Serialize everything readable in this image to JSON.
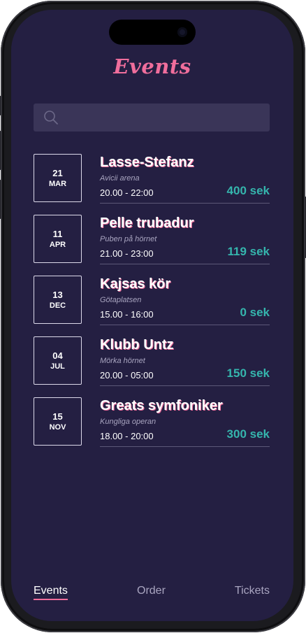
{
  "header": {
    "title": "Events"
  },
  "search": {
    "placeholder": "",
    "value": ""
  },
  "events": [
    {
      "day": "21",
      "month": "MAR",
      "name": "Lasse-Stefanz",
      "venue": "Avicii arena",
      "time": "20.00 - 22:00",
      "price": "400 sek"
    },
    {
      "day": "11",
      "month": "APR",
      "name": "Pelle trubadur",
      "venue": "Puben på hörnet",
      "time": "21.00 - 23:00",
      "price": "119 sek"
    },
    {
      "day": "13",
      "month": "DEC",
      "name": "Kajsas kör",
      "venue": "Götaplatsen",
      "time": "15.00 - 16:00",
      "price": "0 sek"
    },
    {
      "day": "04",
      "month": "JUL",
      "name": "Klubb Untz",
      "venue": "Mörka hörnet",
      "time": "20.00 - 05:00",
      "price": "150 sek"
    },
    {
      "day": "15",
      "month": "NOV",
      "name": "Greats symfoniker",
      "venue": "Kungliga operan",
      "time": "18.00 - 20:00",
      "price": "300 sek"
    }
  ],
  "nav": {
    "events": "Events",
    "order": "Order",
    "tickets": "Tickets",
    "active": "events"
  },
  "colors": {
    "background": "#241f42",
    "accent_pink": "#f06e9c",
    "price_teal": "#35b5ad",
    "search_bg": "#3a3558"
  },
  "icons": {
    "search": "search-icon"
  }
}
